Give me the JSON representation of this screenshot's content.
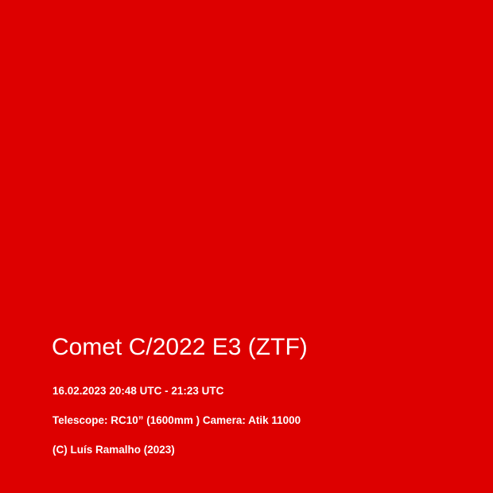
{
  "colors": {
    "background": "#dd0000",
    "text": "#ffffff"
  },
  "title": "Comet C/2022 E3 (ZTF)",
  "date_range": "16.02.2023 20:48 UTC - 21:23 UTC",
  "equipment": "Telescope: RC10” (1600mm )  Camera: Atik 11000",
  "credit": "(C) Luís Ramalho (2023)"
}
